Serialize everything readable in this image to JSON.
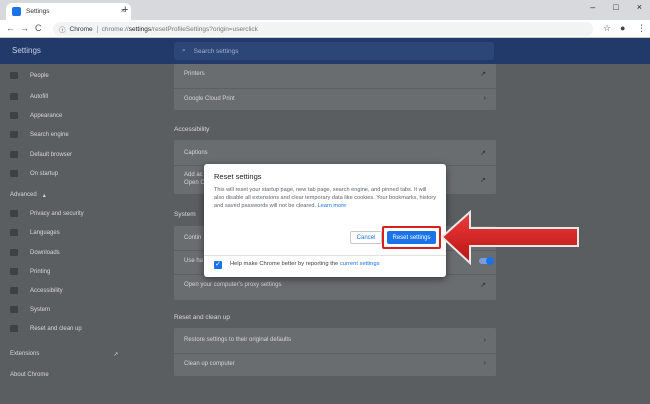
{
  "browser": {
    "tab_title": "Settings",
    "tab_close": "×",
    "new_tab": "+",
    "window_controls": [
      "–",
      "□",
      "×"
    ],
    "nav": [
      "←",
      "→",
      "C"
    ],
    "omnibox_chrome": "Chrome",
    "url_scheme": "chrome://",
    "url_host": "settings",
    "url_path": "/resetProfileSettings?origin=userclick",
    "star_icon": "☆",
    "menu_icon": "⋮"
  },
  "header": {
    "title": "Settings",
    "search_placeholder": "Search settings"
  },
  "sidebar": {
    "items": [
      {
        "label": "People",
        "icon": "person-icon"
      },
      {
        "label": "Autofill",
        "icon": "autofill-icon"
      },
      {
        "label": "Appearance",
        "icon": "palette-icon"
      },
      {
        "label": "Search engine",
        "icon": "search-icon"
      },
      {
        "label": "Default browser",
        "icon": "browser-icon"
      },
      {
        "label": "On startup",
        "icon": "power-icon"
      }
    ],
    "advanced_label": "Advanced",
    "advanced_items": [
      {
        "label": "Privacy and security",
        "icon": "shield-icon"
      },
      {
        "label": "Languages",
        "icon": "globe-icon"
      },
      {
        "label": "Downloads",
        "icon": "download-icon"
      },
      {
        "label": "Printing",
        "icon": "printer-icon"
      },
      {
        "label": "Accessibility",
        "icon": "accessibility-icon"
      },
      {
        "label": "System",
        "icon": "wrench-icon"
      },
      {
        "label": "Reset and clean up",
        "icon": "reset-icon"
      }
    ],
    "extensions_label": "Extensions",
    "about_label": "About Chrome"
  },
  "main": {
    "printers": "Printers",
    "cloud_print": "Google Cloud Print",
    "accessibility_heading": "Accessibility",
    "captions": "Captions",
    "add_access_1": "Add ac",
    "add_access_2": "Open Ch",
    "system_heading": "System",
    "continue_apps": "Contin",
    "use_hw": "Use ha",
    "proxy": "Open your computer's proxy settings",
    "reset_heading": "Reset and clean up",
    "restore_defaults": "Restore settings to their original defaults",
    "clean_up": "Clean up computer"
  },
  "dialog": {
    "title": "Reset settings",
    "body": "This will reset your startup page, new tab page, search engine, and pinned tabs. It will also disable all extensions and clear temporary data like cookies. Your bookmarks, history and saved passwords will not be cleared.",
    "learn_more": "Learn more",
    "cancel_label": "Cancel",
    "reset_label": "Reset settings",
    "checkbox_label": "Help make Chrome better by reporting the",
    "checkbox_link": "current settings",
    "checkbox_checked": "✓"
  },
  "colors": {
    "accent": "#1a73e8",
    "highlight": "#d81e1e"
  }
}
